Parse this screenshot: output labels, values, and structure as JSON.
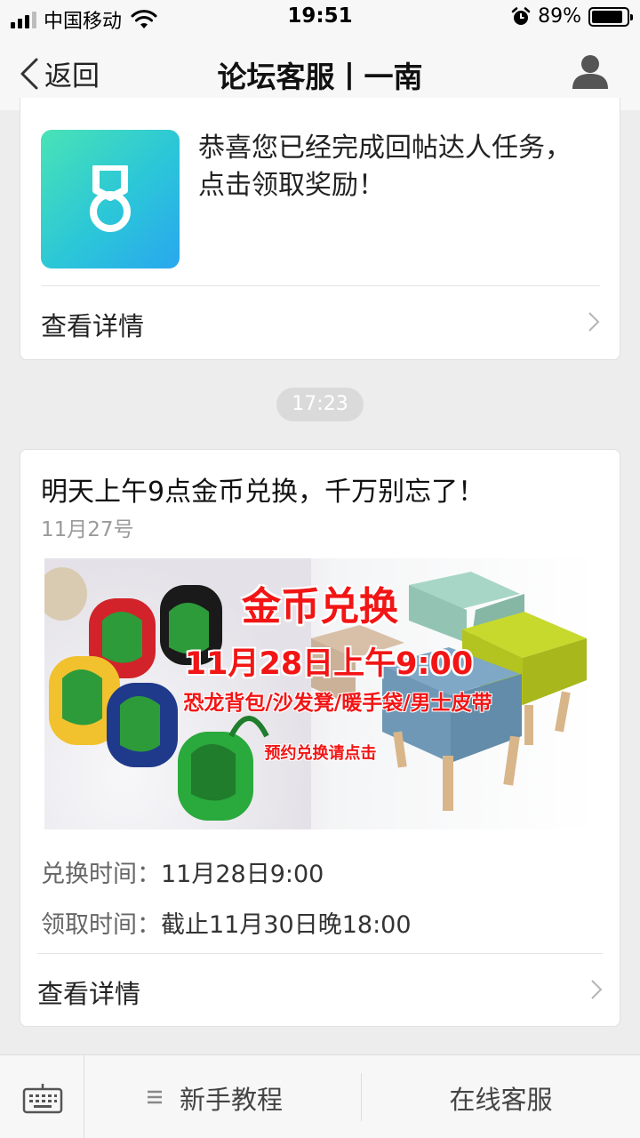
{
  "status_bar": {
    "carrier": "中国移动",
    "time": "19:51",
    "battery": "89%",
    "battery_level": 0.89,
    "icons": [
      "signal-icon",
      "wifi-icon",
      "alarm-icon",
      "battery-icon"
    ]
  },
  "nav": {
    "back_label": "返回",
    "title": "论坛客服丨一南",
    "right_icon": "profile-icon"
  },
  "messages": [
    {
      "icon": "medal-icon",
      "text": "恭喜您已经完成回帖达人任务，点击领取奖励！",
      "detail_label": "查看详情"
    },
    {
      "title": "明天上午9点金币兑换，千万别忘了！",
      "date": "11月27号",
      "banner": {
        "headline": "金币兑换",
        "date_line": "11月28日上午9:00",
        "products": "恐龙背包/沙发凳/暖手袋/男士皮带",
        "cta": "预约兑换请点击"
      },
      "exchange_label": "兑换时间：",
      "exchange_value": "11月28日9:00",
      "claim_label": "领取时间：",
      "claim_value": "截止11月30日晚18:00",
      "detail_label": "查看详情"
    }
  ],
  "timestamp": "17:23",
  "bottom_bar": {
    "keyboard_icon": "keyboard-icon",
    "menu_icon": "menu-icon",
    "menu1": "新手教程",
    "menu2": "在线客服"
  },
  "colors": {
    "accent_red": "#f21515",
    "medal_gradient_start": "#49e3b6",
    "medal_gradient_end": "#2aa7ef",
    "background": "#ededed"
  }
}
